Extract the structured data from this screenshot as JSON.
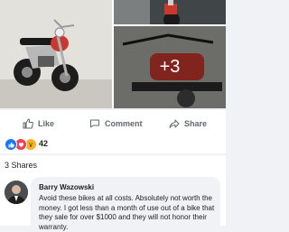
{
  "photos": {
    "more_count": "+3"
  },
  "actions": {
    "like_label": "Like",
    "comment_label": "Comment",
    "share_label": "Share"
  },
  "reactions": {
    "icons": [
      "like-reaction-icon",
      "love-reaction-icon",
      "wow-reaction-icon"
    ],
    "count": "42"
  },
  "shares": {
    "label": "3 Shares"
  },
  "comment": {
    "author": "Barry Wazowski",
    "text": "Avoid these bikes at all costs. Absolutely not worth the money. I got less than a month of use out of a bike that they sale for over $1000 and they will not honor their warranty."
  },
  "colors": {
    "like_blue": "#1877f2",
    "love_red": "#f33e58",
    "wow_yellow": "#f7b125",
    "action_gray": "#606770"
  }
}
